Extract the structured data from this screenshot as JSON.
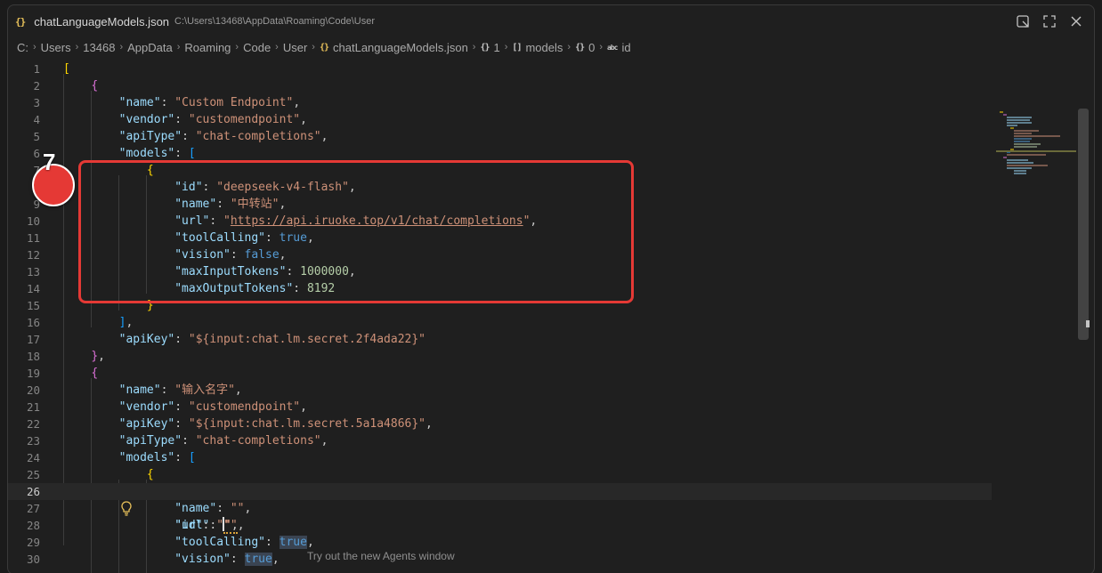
{
  "window": {
    "title": "chatLanguageModels.json",
    "path": "C:\\Users\\13468\\AppData\\Roaming\\Code\\User",
    "file_icon": "json-brace-icon"
  },
  "breadcrumb": [
    "C:",
    "Users",
    "13468",
    "AppData",
    "Roaming",
    "Code",
    "User",
    "chatLanguageModels.json",
    "1",
    "models",
    "0",
    "id"
  ],
  "annotation": {
    "step": "7",
    "color": "#e53935"
  },
  "editor": {
    "current_line": "26",
    "lines": [
      {
        "n": "1"
      },
      {
        "n": "2"
      },
      {
        "n": "3"
      },
      {
        "n": "4"
      },
      {
        "n": "5"
      },
      {
        "n": "6"
      },
      {
        "n": "7"
      },
      {
        "n": "8"
      },
      {
        "n": "9"
      },
      {
        "n": "10"
      },
      {
        "n": "11"
      },
      {
        "n": "12"
      },
      {
        "n": "13"
      },
      {
        "n": "14"
      },
      {
        "n": "15"
      },
      {
        "n": "16"
      },
      {
        "n": "17"
      },
      {
        "n": "18"
      },
      {
        "n": "19"
      },
      {
        "n": "20"
      },
      {
        "n": "21"
      },
      {
        "n": "22"
      },
      {
        "n": "23"
      },
      {
        "n": "24"
      },
      {
        "n": "25"
      },
      {
        "n": "26"
      },
      {
        "n": "27"
      },
      {
        "n": "28"
      },
      {
        "n": "29"
      },
      {
        "n": "30"
      }
    ],
    "entries": {
      "k_name": "\"name\"",
      "k_vendor": "\"vendor\"",
      "k_apiType": "\"apiType\"",
      "k_models": "\"models\"",
      "k_id": "\"id\"",
      "k_url": "\"url\"",
      "k_toolCalling": "\"toolCalling\"",
      "k_vision": "\"vision\"",
      "k_maxInputTokens": "\"maxInputTokens\"",
      "k_maxOutputTokens": "\"maxOutputTokens\"",
      "k_apiKey": "\"apiKey\"",
      "v_name1": "\"Custom Endpoint\"",
      "v_vendor": "\"customendpoint\"",
      "v_apiType": "\"chat-completions\"",
      "v_id1": "\"deepseek-v4-flash\"",
      "v_name_model1": "\"中转站\"",
      "v_url1_open": "\"",
      "v_url1_link": "https://api.iruoke.top/v1/chat/completions",
      "v_url1_close": "\"",
      "v_true": "true",
      "v_false": "false",
      "v_maxIn": "1000000",
      "v_maxOut": "8192",
      "v_apiKey1": "\"${input:chat.lm.secret.2f4ada22}\"",
      "v_name2": "\"输入名字\"",
      "v_apiKey2": "\"${input:chat.lm.secret.5a1a4866}\"",
      "v_empty": "\"\""
    }
  },
  "bottom_hint": "Try out the new Agents window"
}
